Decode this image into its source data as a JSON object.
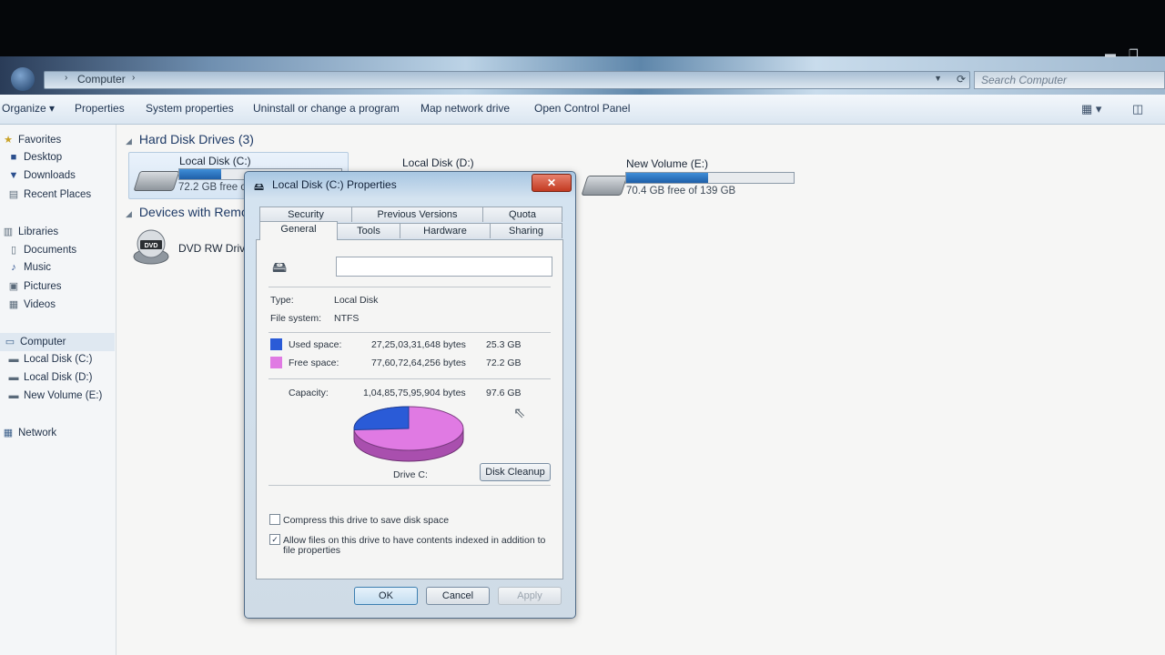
{
  "address_bar": {
    "breadcrumb": "Computer",
    "chevron": "›"
  },
  "search": {
    "placeholder": "Search Computer"
  },
  "window_controls": {
    "minimize": "▬",
    "restore": "❐"
  },
  "toolbar": {
    "organize": "Organize ▾",
    "properties": "Properties",
    "system_properties": "System properties",
    "uninstall": "Uninstall or change a program",
    "map_network": "Map network drive",
    "control_panel": "Open Control Panel"
  },
  "nav": {
    "favorites": "Favorites",
    "desktop": "Desktop",
    "downloads": "Downloads",
    "recent_places": "Recent Places",
    "libraries": "Libraries",
    "documents": "Documents",
    "music": "Music",
    "pictures": "Pictures",
    "videos": "Videos",
    "computer": "Computer",
    "local_c": "Local Disk (C:)",
    "local_d": "Local Disk (D:)",
    "new_volume_e": "New Volume (E:)",
    "network": "Network"
  },
  "content": {
    "hard_disk_group": "Hard Disk Drives (3)",
    "devices_group": "Devices with Remo",
    "drive_c": {
      "name": "Local Disk (C:)",
      "free": "72.2 GB free o",
      "used_fraction": 0.26
    },
    "drive_d": {
      "name": "Local Disk (D:)"
    },
    "drive_e": {
      "name": "New Volume (E:)",
      "free": "70.4 GB free of 139 GB",
      "used_fraction": 0.49
    },
    "dvd": {
      "name": "DVD RW Drive",
      "icon_label": "DVD"
    }
  },
  "dialog": {
    "title": "Local Disk (C:) Properties",
    "close": "✕",
    "tabs_back": [
      "Security",
      "Previous Versions",
      "Quota"
    ],
    "tabs_front": [
      "General",
      "Tools",
      "Hardware",
      "Sharing"
    ],
    "type_label": "Type:",
    "type_value": "Local Disk",
    "fs_label": "File system:",
    "fs_value": "NTFS",
    "used_label": "Used space:",
    "used_bytes": "27,25,03,31,648 bytes",
    "used_gb": "25.3 GB",
    "free_label": "Free space:",
    "free_bytes": "77,60,72,64,256 bytes",
    "free_gb": "72.2 GB",
    "capacity_label": "Capacity:",
    "capacity_bytes": "1,04,85,75,95,904 bytes",
    "capacity_gb": "97.6 GB",
    "pie_label": "Drive C:",
    "used_color": "#2a5bd7",
    "free_color": "#e07ae3",
    "used_fraction": 0.26,
    "disk_cleanup": "Disk Cleanup",
    "compress_label": "Compress this drive to save disk space",
    "compress_checked": false,
    "index_label_1": "Allow files on this drive to have contents indexed in addition to",
    "index_label_2": "file properties",
    "index_checked": true,
    "index_mark": "✓",
    "ok": "OK",
    "cancel": "Cancel",
    "apply": "Apply"
  }
}
